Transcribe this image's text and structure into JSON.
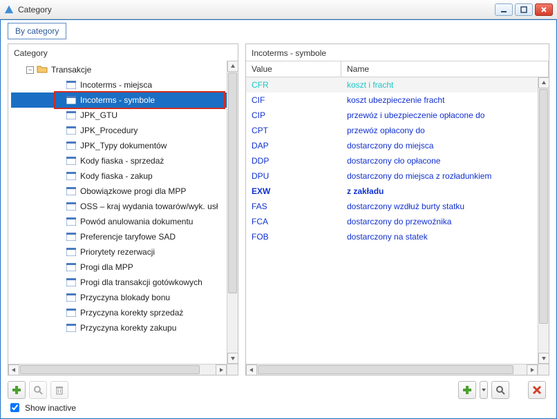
{
  "window": {
    "title": "Category"
  },
  "ribbon": {
    "tab_label": "By category"
  },
  "left_panel": {
    "title": "Category",
    "root_label": "Transakcje",
    "items": [
      "Incoterms - miejsca",
      "Incoterms - symbole",
      "JPK_GTU",
      "JPK_Procedury",
      "JPK_Typy dokumentów",
      "Kody fiaska - sprzedaż",
      "Kody fiaska - zakup",
      "Obowiązkowe progi dla MPP",
      "OSS – kraj wydania towarów/wyk. usł",
      "Powód anulowania dokumentu",
      "Preferencje taryfowe SAD",
      "Priorytety rezerwacji",
      "Progi dla MPP",
      "Progi dla transakcji gotówkowych",
      "Przyczyna blokady bonu",
      "Przyczyna korekty sprzedaż",
      "Przyczyna korekty zakupu"
    ],
    "selected_index": 1
  },
  "right_panel": {
    "title": "Incoterms - symbole",
    "columns": {
      "value": "Value",
      "name": "Name"
    },
    "rows": [
      {
        "value": "CFR",
        "name": "koszt i fracht",
        "selected": true
      },
      {
        "value": "CIF",
        "name": "koszt ubezpieczenie fracht"
      },
      {
        "value": "CIP",
        "name": "przewóz i ubezpieczenie opłacone do"
      },
      {
        "value": "CPT",
        "name": "przewóz opłacony do"
      },
      {
        "value": "DAP",
        "name": "dostarczony do miejsca"
      },
      {
        "value": "DDP",
        "name": "dostarczony cło opłacone"
      },
      {
        "value": "DPU",
        "name": "dostarczony do miejsca z rozładunkiem"
      },
      {
        "value": "EXW",
        "name": "z zakładu",
        "bold": true
      },
      {
        "value": "FAS",
        "name": "dostarczony wzdłuż burty statku"
      },
      {
        "value": "FCA",
        "name": "dostarczony do przewoźnika"
      },
      {
        "value": "FOB",
        "name": "dostarczony na statek"
      }
    ]
  },
  "footer": {
    "show_inactive_label": "Show inactive",
    "show_inactive_checked": true
  },
  "icons": {
    "add": "plus-icon",
    "search": "magnifier-icon",
    "delete": "trash-icon",
    "close_action": "red-x-icon"
  }
}
